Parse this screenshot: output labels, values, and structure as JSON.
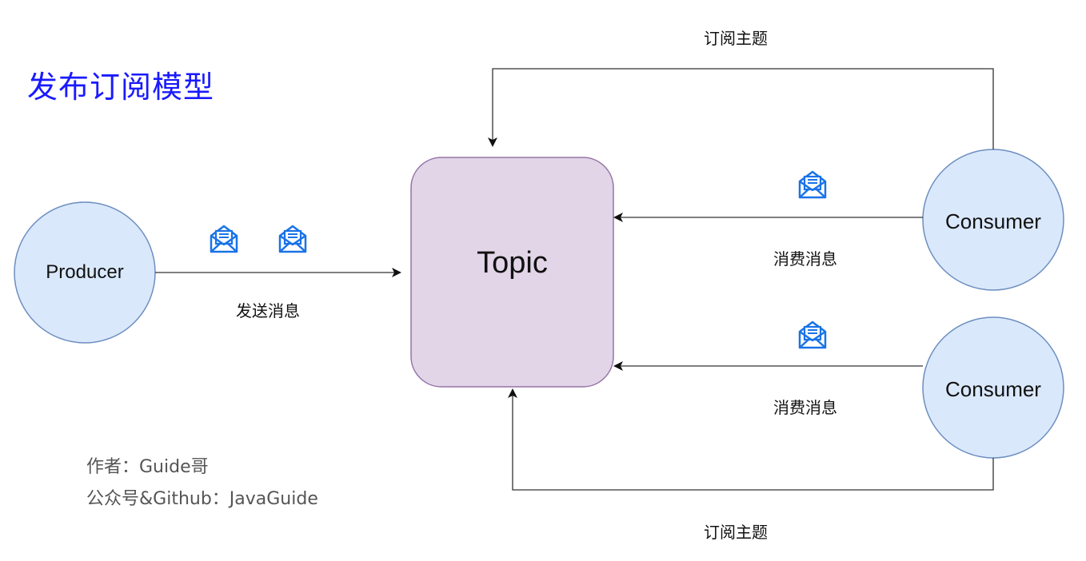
{
  "title": "发布订阅模型",
  "nodes": {
    "producer": "Producer",
    "topic": "Topic",
    "consumer_top": "Consumer",
    "consumer_bottom": "Consumer"
  },
  "edges": {
    "send": "发送消息",
    "consume_top": "消费消息",
    "consume_bottom": "消费消息",
    "subscribe_top": "订阅主题",
    "subscribe_bottom": "订阅主题"
  },
  "author": {
    "line1": "作者：Guide哥",
    "line2": "公众号&Github：JavaGuide"
  },
  "icons": [
    "envelope-icon",
    "envelope-icon",
    "envelope-icon",
    "envelope-icon"
  ],
  "colors": {
    "node_fill": "#dae8fc",
    "node_stroke": "#6c8ebf",
    "topic_fill": "#e1d5e7",
    "topic_stroke": "#9673a6",
    "title": "#1a1aff",
    "icon": "#1a73e8"
  }
}
